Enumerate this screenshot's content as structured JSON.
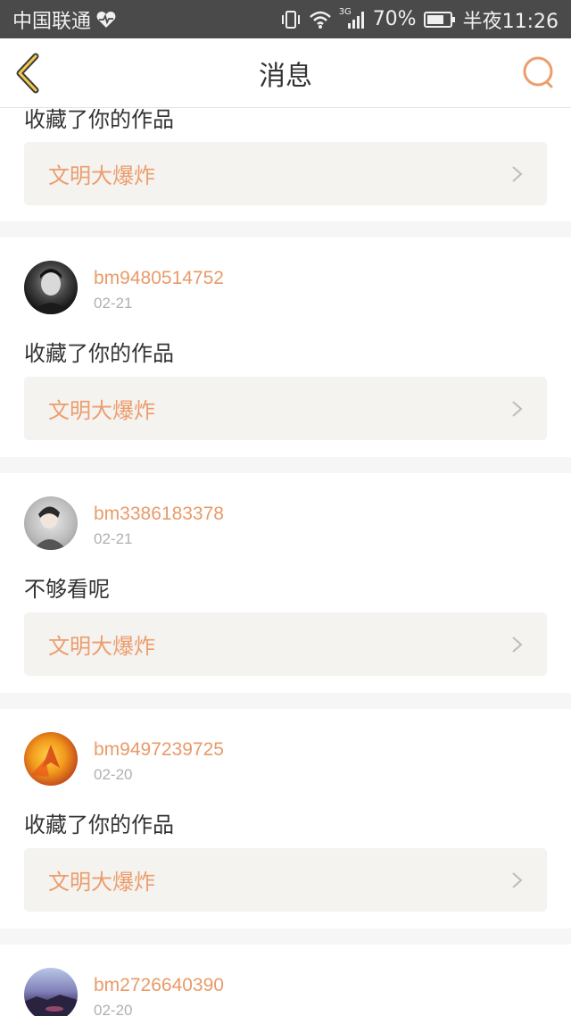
{
  "status_bar": {
    "carrier": "中国联通",
    "network": "3G",
    "battery": "70%",
    "time": "半夜11:26"
  },
  "header": {
    "title": "消息"
  },
  "messages": [
    {
      "text": "收藏了你的作品",
      "work_title": "文明大爆炸"
    },
    {
      "username": "bm9480514752",
      "date": "02-21",
      "text": "收藏了你的作品",
      "work_title": "文明大爆炸"
    },
    {
      "username": "bm3386183378",
      "date": "02-21",
      "text": "不够看呢",
      "work_title": "文明大爆炸"
    },
    {
      "username": "bm9497239725",
      "date": "02-20",
      "text": "收藏了你的作品",
      "work_title": "文明大爆炸"
    },
    {
      "username": "bm2726640390",
      "date": "02-20"
    }
  ],
  "colors": {
    "accent": "#ec9d6e",
    "status_bar": "#4a4a4a",
    "card_link_bg": "#f4f3ef"
  },
  "icons": {
    "back": "chevron-left-icon",
    "search": "search-icon",
    "link": "chevron-right-icon"
  }
}
